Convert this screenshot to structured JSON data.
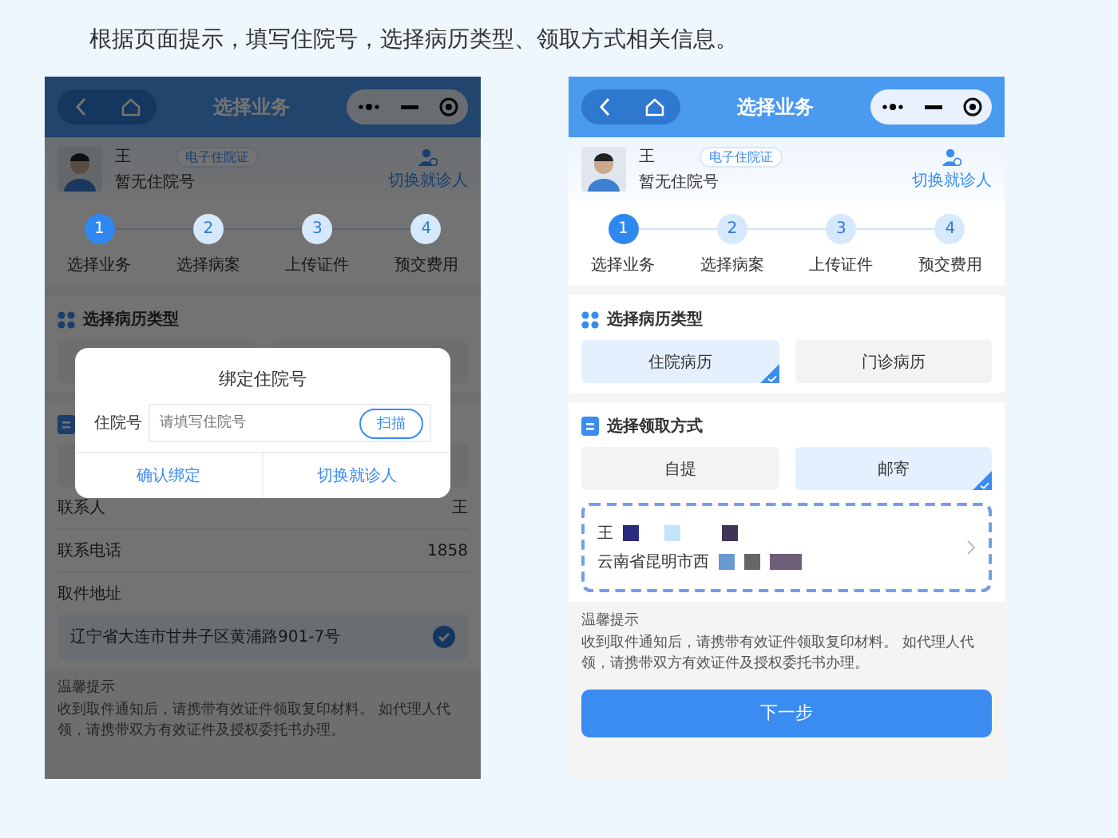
{
  "instruction": "根据页面提示，填写住院号，选择病历类型、领取方式相关信息。",
  "phones": [
    {
      "kind": "dimmed",
      "nav_title": "选择业务",
      "patient": {
        "name": "王",
        "tag": "电子住院证",
        "number": "暂无住院号",
        "switch": "切换就诊人"
      },
      "steps": [
        {
          "number": "1",
          "label": "选择业务",
          "selected": true
        },
        {
          "number": "2",
          "label": "选择病案",
          "selected": false
        },
        {
          "number": "3",
          "label": "上传证件",
          "selected": false
        },
        {
          "number": "4",
          "label": "预交费用",
          "selected": false
        }
      ],
      "record_type": {
        "title": "选择病历类型"
      },
      "contact": [
        {
          "label": "联系人",
          "value": "王"
        },
        {
          "label": "联系电话",
          "value": "1858"
        }
      ],
      "address": {
        "label": "取件地址",
        "text": "辽宁省大连市甘井子区黄浦路901-7号",
        "checked": true
      },
      "tip": {
        "title": "温馨提示",
        "text": "收到取件通知后，请携带有效证件领取复印材料。 如代理人代领，请携带双方有效证件及授权委托书办理。"
      },
      "dialog": {
        "title": "绑定住院号",
        "field_label": "住院号",
        "placeholder": "请填写住院号",
        "scan": "扫描",
        "actions": [
          "确认绑定",
          "切换就诊人"
        ]
      }
    },
    {
      "kind": "normal",
      "nav_title": "选择业务",
      "patient": {
        "name": "王",
        "tag": "电子住院证",
        "number": "暂无住院号",
        "switch": "切换就诊人"
      },
      "steps": [
        {
          "number": "1",
          "label": "选择业务",
          "selected": true
        },
        {
          "number": "2",
          "label": "选择病案",
          "selected": false
        },
        {
          "number": "3",
          "label": "上传证件",
          "selected": false
        },
        {
          "number": "4",
          "label": "预交费用",
          "selected": false
        }
      ],
      "record_type": {
        "title": "选择病历类型",
        "options": [
          {
            "label": "住院病历",
            "selected": true
          },
          {
            "label": "门诊病历",
            "selected": false
          }
        ]
      },
      "pickup": {
        "title": "选择领取方式",
        "options": [
          {
            "label": "自提",
            "selected": false
          },
          {
            "label": "邮寄",
            "selected": true
          }
        ]
      },
      "mail_address": {
        "name": "王",
        "text": "云南省昆明市西"
      },
      "tip": {
        "title": "温馨提示",
        "text": "收到取件通知后，请携带有效证件领取复印材料。 如代理人代领，请携带双方有效证件及授权委托书办理。"
      },
      "next_button": "下一步"
    }
  ]
}
